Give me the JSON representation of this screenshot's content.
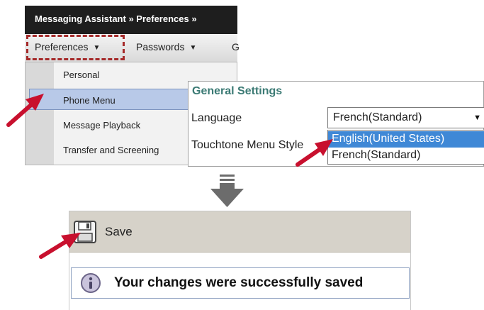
{
  "app": {
    "breadcrumb": "Messaging Assistant » Preferences »"
  },
  "menubar": {
    "preferences_label": "Preferences",
    "passwords_label": "Passwords",
    "partial_label": "G"
  },
  "preferences_menu": {
    "items": [
      {
        "label": "Personal"
      },
      {
        "label": "Phone Menu"
      },
      {
        "label": "Message Playback"
      },
      {
        "label": "Transfer and Screening"
      }
    ],
    "selected_index": 1
  },
  "general_settings": {
    "title": "General Settings",
    "language_label": "Language",
    "language_value": "French(Standard)",
    "touchtone_label": "Touchtone Menu Style",
    "language_options": [
      "English(United States)",
      "French(Standard)"
    ],
    "highlighted_option_index": 0
  },
  "save_panel": {
    "save_label": "Save",
    "success_message": "Your changes were successfully saved"
  },
  "colors": {
    "header_bg": "#1e1e1e",
    "highlight_dash": "#a52a2a",
    "menu_selected_bg": "#b8c9e8",
    "option_highlight": "#3f88d6",
    "title_teal": "#3b7a74",
    "pointer_arrow": "#c8102e",
    "toolbar_bg": "#d6d2c9"
  },
  "icons": {
    "save": "floppy-disk-icon",
    "info": "info-icon",
    "flow_arrow": "down-arrow-icon",
    "pointer": "red-pointer-arrow"
  }
}
